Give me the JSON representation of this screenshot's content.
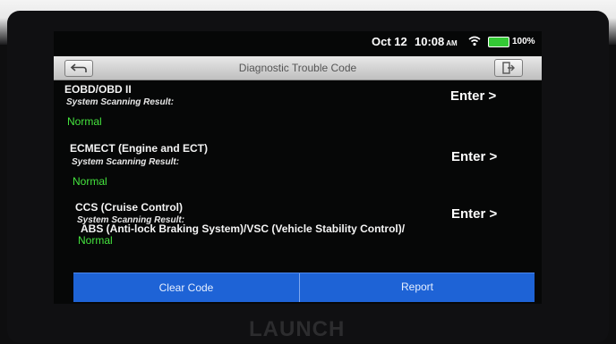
{
  "status_bar": {
    "date": "Oct 12",
    "time": "10:08",
    "ampm": "AM",
    "battery": "100%",
    "icons": [
      "wifi-icon",
      "battery-icon"
    ]
  },
  "title_bar": {
    "title": "Diagnostic Trouble Code",
    "back_icon": "back-arrow-icon",
    "exit_icon": "exit-icon"
  },
  "systems": [
    {
      "name": "EOBD/OBD II",
      "label": "System Scanning Result:",
      "result": "Normal",
      "action": "Enter >"
    },
    {
      "name": "ECMECT (Engine and ECT)",
      "label": "System Scanning Result:",
      "result": "Normal",
      "action": "Enter >"
    },
    {
      "name": "CCS (Cruise Control)",
      "label": "System Scanning Result:",
      "result": "Normal",
      "action": "Enter >"
    },
    {
      "name": "ABS (Anti-lock Braking System)/VSC (Vehicle Stability Control)/"
    }
  ],
  "bottom_bar": {
    "clear_code": "Clear Code",
    "report": "Report"
  },
  "brand": "LAUNCH",
  "colors": {
    "result_normal": "#45e43e",
    "action_bar": "#1e63d6",
    "battery": "#34c935"
  }
}
